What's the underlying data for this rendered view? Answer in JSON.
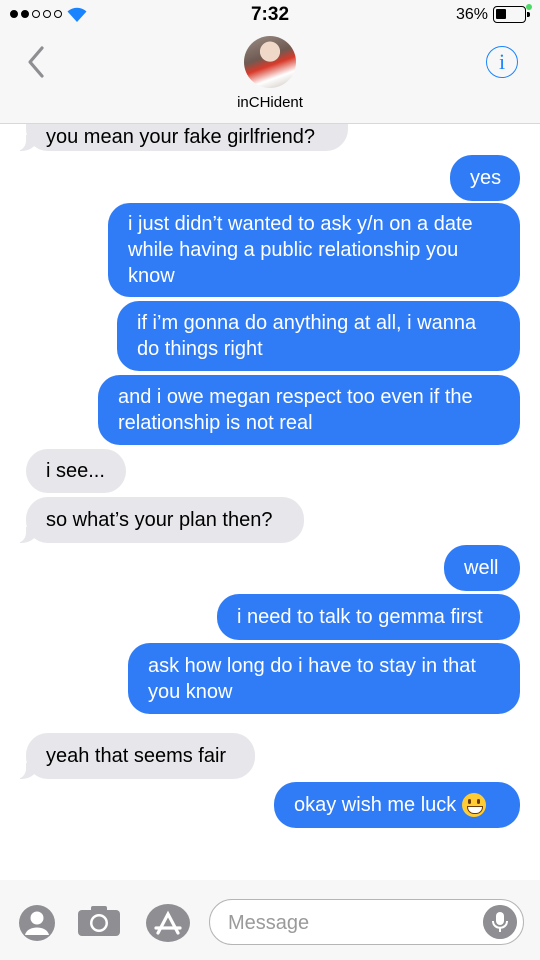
{
  "status_bar": {
    "time": "7:32",
    "battery_percent": "36%",
    "signal_bars": 2,
    "signal_total": 5,
    "battery_level": 0.36
  },
  "header": {
    "contact_name": "inCHident",
    "info_glyph": "i",
    "back_icon": "chevron-left-icon",
    "accent_color": "#1a84ff"
  },
  "messages": [
    {
      "from": "them",
      "text": "you mean your fake girlfriend?"
    },
    {
      "from": "me",
      "text": "yes"
    },
    {
      "from": "me",
      "text": "i just didn’t wanted to ask y/n on a date\nwhile having a public relationship you\nknow"
    },
    {
      "from": "me",
      "text": "if i’m gonna do anything at all, i wanna\ndo things right"
    },
    {
      "from": "me",
      "text": "and i owe megan respect too even if the\nrelationship is not real"
    },
    {
      "from": "them",
      "text": "i see..."
    },
    {
      "from": "them",
      "text": "so what’s your plan then?"
    },
    {
      "from": "me",
      "text": "well"
    },
    {
      "from": "me",
      "text": "i need to talk to gemma first"
    },
    {
      "from": "me",
      "text": "ask how long do i have to stay in that\nyou know"
    },
    {
      "from": "them",
      "text": "yeah that seems fair"
    },
    {
      "from": "me",
      "text": "okay wish me luck",
      "emoji": "grinning-face-emoji"
    }
  ],
  "colors": {
    "sent_bubble": "#2f7cf6",
    "received_bubble": "#e6e6eb",
    "charging_dot": "#4cd964"
  },
  "compose": {
    "placeholder": "Message",
    "icons": [
      "person-icon",
      "camera-icon",
      "app-store-icon",
      "microphone-icon"
    ]
  }
}
